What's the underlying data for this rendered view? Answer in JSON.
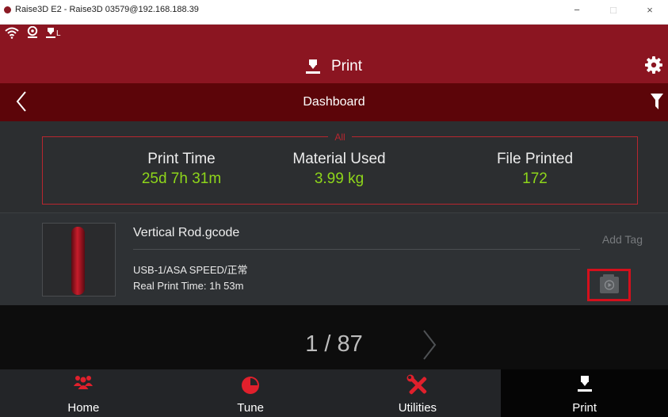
{
  "window": {
    "title": "Raise3D E2 - Raise3D 03579@192.168.188.39",
    "minimize": "−",
    "maximize": "□",
    "close": "×"
  },
  "status": {
    "wifi_icon": "wifi-icon",
    "camera_icon": "webcam-icon",
    "extruder_label": "L"
  },
  "header": {
    "title": "Print",
    "settings_icon": "gear-icon"
  },
  "subheader": {
    "title": "Dashboard",
    "back_icon": "chevron-left-icon",
    "filter_icon": "filter-icon"
  },
  "stats": {
    "legend": "All",
    "items": [
      {
        "label": "Print Time",
        "value": "25d 7h 31m"
      },
      {
        "label": "Material Used",
        "value": "3.99 kg"
      },
      {
        "label": "File Printed",
        "value": "172"
      }
    ]
  },
  "job": {
    "file_name": "Vertical Rod.gcode",
    "source": "USB-1/ASA SPEED/正常",
    "real_print_time": "Real Print Time: 1h 53m",
    "add_tag": "Add Tag",
    "video_icon": "video-play-icon"
  },
  "pager": {
    "text": "1 / 87",
    "next_icon": "chevron-right-icon"
  },
  "nav": {
    "items": [
      {
        "label": "Home",
        "icon": "users-icon"
      },
      {
        "label": "Tune",
        "icon": "pie-chart-icon"
      },
      {
        "label": "Utilities",
        "icon": "tools-icon"
      },
      {
        "label": "Print",
        "icon": "printer-icon"
      }
    ],
    "active_index": 3
  },
  "colors": {
    "brand_red": "#8b1521",
    "dark_red": "#5c0509",
    "value_green": "#8ed61a",
    "highlight_red": "#d4101c",
    "nav_icon_red": "#e0202c"
  }
}
